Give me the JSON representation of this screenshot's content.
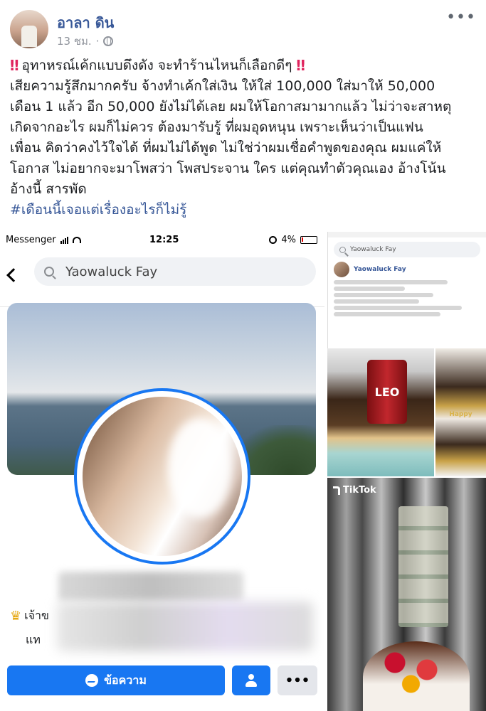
{
  "post": {
    "author": "อาลา ดิน",
    "time": "13 ชม.",
    "separator": "·",
    "more": "•••",
    "lines": [
      "อุทาหรณ์เค้กแบบดึงดัง จะทำร้านไหนก็เลือกดีๆ",
      "เสียความรู้สึกมากครับ จ้างทำเค้กใส่เงิน ให้ใส่ 100,000 ใส่มาให้ 50,000",
      "เดือน 1 แล้ว อีก 50,000 ยังไม่ได้เลย ผมให้โอกาสมามากแล้ว ไม่ว่าจะสาหตุ",
      "เกิดจากอะไร ผมก็ไม่ควร ต้องมารับรู้ ที่ผมอุดหนุน เพราะเห็นว่าเป็นแฟน",
      "เพื่อน คิดว่าคงไว้ใจได้ ที่ผมไม่ได้พูด ไม่ใช่ว่าผมเชื่อคำพูดของคุณ ผมแค่ให้",
      "โอกาส ไม่อยากจะมาโพสว่า โพสประจาน ใคร แต่คุณทำตัวคุณเอง อ้างโน้น",
      "อ้างนี้ สารพัด"
    ],
    "hashtag": "#เดือนนี้เจอแต่เรื่องอะไรก็ไม่รู้",
    "bangbang": "‼"
  },
  "screenshot": {
    "status": {
      "app": "Messenger",
      "time": "12:25",
      "battery": "4%"
    },
    "search_value": "Yaowaluck Fay",
    "bio_prefix": "เจ้าข",
    "bio_line2": "แท",
    "message_label": "ข้อความ",
    "more_label": "•••"
  },
  "right": {
    "search_value": "Yaowaluck Fay",
    "author": "Yaowaluck Fay",
    "cake_label": "LEO",
    "cake2_text": "Happy",
    "tiktok_label": "TikTok"
  },
  "colors": {
    "link": "#385898",
    "accent": "#1877f2",
    "bangbang": "#e0245e"
  }
}
